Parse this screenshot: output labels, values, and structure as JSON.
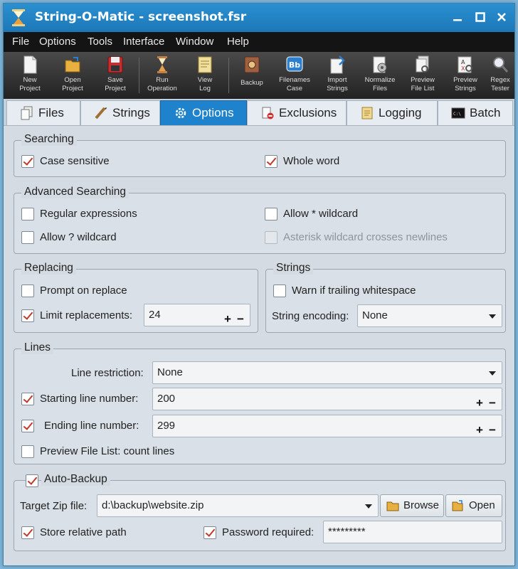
{
  "window": {
    "title": "String-O-Matic - screenshot.fsr"
  },
  "menu": [
    "File",
    "Options",
    "Tools",
    "Interface",
    "Window",
    "Help"
  ],
  "toolbar": [
    {
      "label": "New\nProject",
      "icon": "new-project-icon"
    },
    {
      "label": "Open\nProject",
      "icon": "open-project-icon"
    },
    {
      "label": "Save\nProject",
      "icon": "save-project-icon"
    },
    {
      "label": "Run\nOperation",
      "icon": "run-operation-icon"
    },
    {
      "label": "View\nLog",
      "icon": "view-log-icon"
    },
    {
      "label": "Backup",
      "icon": "backup-icon"
    },
    {
      "label": "Filenames\nCase",
      "icon": "filenames-case-icon"
    },
    {
      "label": "Import\nStrings",
      "icon": "import-strings-icon"
    },
    {
      "label": "Normalize\nFiles",
      "icon": "normalize-files-icon"
    },
    {
      "label": "Preview\nFile List",
      "icon": "preview-file-list-icon"
    },
    {
      "label": "Preview\nStrings",
      "icon": "preview-strings-icon"
    },
    {
      "label": "Regex\nTester",
      "icon": "regex-tester-icon"
    }
  ],
  "tabs": [
    {
      "label": "Files",
      "active": false
    },
    {
      "label": "Strings",
      "active": false
    },
    {
      "label": "Options",
      "active": true
    },
    {
      "label": "Exclusions",
      "active": false
    },
    {
      "label": "Logging",
      "active": false
    },
    {
      "label": "Batch",
      "active": false
    }
  ],
  "searching": {
    "title": "Searching",
    "case_sensitive": {
      "label": "Case sensitive",
      "checked": true
    },
    "whole_word": {
      "label": "Whole word",
      "checked": true
    }
  },
  "advanced": {
    "title": "Advanced Searching",
    "regex": {
      "label": "Regular expressions",
      "checked": false
    },
    "star_wildcard": {
      "label": "Allow * wildcard",
      "checked": false
    },
    "q_wildcard": {
      "label": "Allow ? wildcard",
      "checked": false
    },
    "asterisk_newlines": {
      "label": "Asterisk wildcard crosses newlines",
      "checked": false,
      "disabled": true
    }
  },
  "replacing": {
    "title": "Replacing",
    "prompt": {
      "label": "Prompt on replace",
      "checked": false
    },
    "limit": {
      "label": "Limit replacements:",
      "checked": true,
      "value": "24"
    }
  },
  "strings": {
    "title": "Strings",
    "warn_trailing": {
      "label": "Warn if trailing whitespace",
      "checked": false
    },
    "encoding_label": "String encoding:",
    "encoding_value": "None"
  },
  "lines": {
    "title": "Lines",
    "restriction_label": "Line restriction:",
    "restriction_value": "None",
    "start": {
      "label": "Starting line number:",
      "checked": true,
      "value": "200"
    },
    "end": {
      "label": "Ending line number:",
      "checked": true,
      "value": "299"
    },
    "count_lines": {
      "label": "Preview File List: count lines",
      "checked": false
    }
  },
  "autobackup": {
    "title": "Auto-Backup",
    "checked": true,
    "zip_label": "Target Zip file:",
    "zip_value": "d:\\backup\\website.zip",
    "browse": "Browse",
    "open": "Open",
    "relative": {
      "label": "Store relative path",
      "checked": true
    },
    "password": {
      "label": "Password required:",
      "checked": true,
      "value": "*********"
    }
  },
  "spin_plus": "+",
  "spin_minus": "−",
  "colors": {
    "active_tab": "#1f82cc",
    "titlebar": "#2a8fd0",
    "check": "#c0392b"
  }
}
